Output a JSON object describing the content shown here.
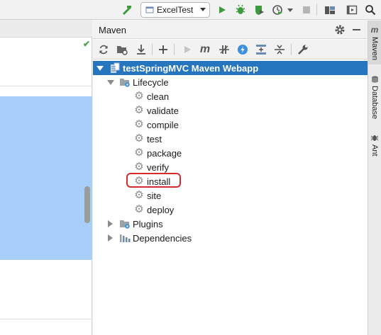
{
  "run_config": {
    "label": "ExcelTest"
  },
  "maven": {
    "title": "Maven",
    "project": "testSpringMVC Maven Webapp",
    "lifecycle_label": "Lifecycle",
    "phases": [
      "clean",
      "validate",
      "compile",
      "test",
      "package",
      "verify",
      "install",
      "site",
      "deploy"
    ],
    "plugins_label": "Plugins",
    "dependencies_label": "Dependencies",
    "toolbar_m": "m"
  },
  "right_strip": {
    "maven_tab": "Maven",
    "database_tab": "Database",
    "ant_tab": "Ant",
    "m_logo": "m"
  },
  "colors": {
    "selection": "#2675bf",
    "highlight_box": "#d92b2b",
    "editor_selection": "#a6cef8",
    "run_green": "#3c9c3c"
  }
}
